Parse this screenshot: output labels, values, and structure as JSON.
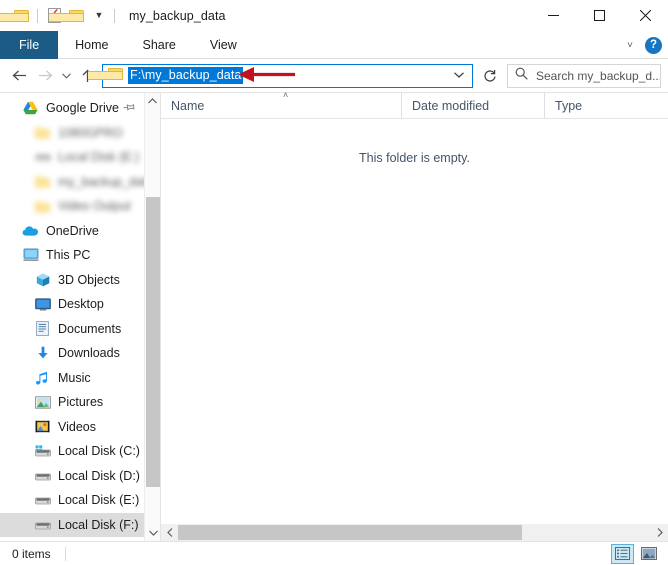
{
  "window": {
    "title": "my_backup_data",
    "quick_access": [
      {
        "name": "folder-icon",
        "label": "Folder"
      },
      {
        "name": "properties-icon",
        "label": "Properties"
      },
      {
        "name": "new-folder-icon",
        "label": "New folder"
      },
      {
        "name": "customize-dropdown-icon",
        "label": "Customize Quick Access Toolbar"
      }
    ],
    "controls": [
      {
        "name": "minimize-button",
        "label": "Minimize"
      },
      {
        "name": "maximize-button",
        "label": "Maximize"
      },
      {
        "name": "close-button",
        "label": "Close"
      }
    ]
  },
  "ribbon": {
    "tabs": [
      {
        "label": "File",
        "active": true
      },
      {
        "label": "Home",
        "active": false
      },
      {
        "label": "Share",
        "active": false
      },
      {
        "label": "View",
        "active": false
      }
    ],
    "expand_label": "˅",
    "help_label": "?"
  },
  "addressbar": {
    "back_label": "Back",
    "forward_label": "Forward",
    "recent_label": "Recent locations",
    "up_label": "Up",
    "path": "F:\\my_backup_data",
    "path_selected": true,
    "dropdown_label": "˅",
    "refresh_label": "Refresh"
  },
  "search": {
    "placeholder": "Search my_backup_d...",
    "icon": "search-icon"
  },
  "sidebar": {
    "items": [
      {
        "label": "Google Drive",
        "icon": "google-drive-icon",
        "level": 0,
        "pinned": true,
        "blurred": false,
        "selected": false
      },
      {
        "label": "1080GPRO",
        "icon": "folder-icon",
        "level": 1,
        "pinned": false,
        "blurred": true,
        "selected": false
      },
      {
        "label": "Local Disk (E:)",
        "icon": "drive-icon",
        "level": 1,
        "pinned": false,
        "blurred": true,
        "selected": false
      },
      {
        "label": "my_backup_data",
        "icon": "folder-icon",
        "level": 1,
        "pinned": false,
        "blurred": true,
        "selected": false
      },
      {
        "label": "Video Output",
        "icon": "folder-icon",
        "level": 1,
        "pinned": false,
        "blurred": true,
        "selected": false
      },
      {
        "label": "OneDrive",
        "icon": "onedrive-icon",
        "level": 0,
        "pinned": false,
        "blurred": false,
        "selected": false
      },
      {
        "label": "This PC",
        "icon": "this-pc-icon",
        "level": 0,
        "pinned": false,
        "blurred": false,
        "selected": false
      },
      {
        "label": "3D Objects",
        "icon": "3d-objects-icon",
        "level": 1,
        "pinned": false,
        "blurred": false,
        "selected": false
      },
      {
        "label": "Desktop",
        "icon": "desktop-icon",
        "level": 1,
        "pinned": false,
        "blurred": false,
        "selected": false
      },
      {
        "label": "Documents",
        "icon": "documents-icon",
        "level": 1,
        "pinned": false,
        "blurred": false,
        "selected": false
      },
      {
        "label": "Downloads",
        "icon": "downloads-icon",
        "level": 1,
        "pinned": false,
        "blurred": false,
        "selected": false
      },
      {
        "label": "Music",
        "icon": "music-icon",
        "level": 1,
        "pinned": false,
        "blurred": false,
        "selected": false
      },
      {
        "label": "Pictures",
        "icon": "pictures-icon",
        "level": 1,
        "pinned": false,
        "blurred": false,
        "selected": false
      },
      {
        "label": "Videos",
        "icon": "videos-icon",
        "level": 1,
        "pinned": false,
        "blurred": false,
        "selected": false
      },
      {
        "label": "Local Disk (C:)",
        "icon": "windows-drive-icon",
        "level": 1,
        "pinned": false,
        "blurred": false,
        "selected": false
      },
      {
        "label": "Local Disk (D:)",
        "icon": "drive-icon",
        "level": 1,
        "pinned": false,
        "blurred": false,
        "selected": false
      },
      {
        "label": "Local Disk (E:)",
        "icon": "drive-icon",
        "level": 1,
        "pinned": false,
        "blurred": false,
        "selected": false
      },
      {
        "label": "Local Disk (F:)",
        "icon": "drive-icon",
        "level": 1,
        "pinned": false,
        "blurred": false,
        "selected": true
      }
    ]
  },
  "columns": [
    {
      "label": "Name",
      "sorted": "asc",
      "sort_glyph": "˄"
    },
    {
      "label": "Date modified",
      "sorted": null,
      "sort_glyph": ""
    },
    {
      "label": "Type",
      "sorted": null,
      "sort_glyph": ""
    }
  ],
  "filelist": {
    "empty_message": "This folder is empty.",
    "rows": []
  },
  "statusbar": {
    "item_count": "0 items",
    "views": [
      {
        "name": "details-view-button",
        "label": "Details view",
        "active": true
      },
      {
        "name": "large-icons-view-button",
        "label": "Large icons view",
        "active": false
      }
    ]
  },
  "annotation": {
    "arrow_color": "#c1121f",
    "points_to": "address-bar-path"
  }
}
